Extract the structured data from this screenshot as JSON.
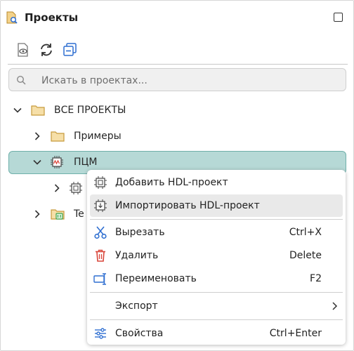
{
  "panel": {
    "title": "Проекты",
    "header_icon": "project-search-icon"
  },
  "toolbar": {
    "items": [
      {
        "icon": "eye-document-icon"
      },
      {
        "icon": "refresh-icon"
      },
      {
        "icon": "collapse-all-icon"
      }
    ]
  },
  "search": {
    "placeholder": "Искать в проектах..."
  },
  "tree": {
    "root": {
      "label": "ВСЕ ПРОЕКТЫ",
      "expanded": true,
      "icon": "folder-icon"
    },
    "examples": {
      "label": "Примеры",
      "expanded": false,
      "icon": "folder-icon"
    },
    "pcm": {
      "label": "ПЦМ",
      "expanded": true,
      "selected": true,
      "icon": "chip-signal-icon"
    },
    "pcm_child": {
      "label": "",
      "icon": "chip-icon"
    },
    "test": {
      "label": "Te",
      "icon": "folder-badge-icon"
    }
  },
  "context_menu": {
    "items": [
      {
        "label": "Добавить HDL-проект",
        "shortcut": "",
        "icon": "chip-add-icon"
      },
      {
        "label": "Импортировать HDL-проект",
        "shortcut": "",
        "icon": "chip-import-icon"
      },
      {
        "label": "Вырезать",
        "shortcut": "Ctrl+X",
        "icon": "scissors-icon"
      },
      {
        "label": "Удалить",
        "shortcut": "Delete",
        "icon": "trash-icon"
      },
      {
        "label": "Переименовать",
        "shortcut": "F2",
        "icon": "rename-icon"
      },
      {
        "label": "Экспорт",
        "shortcut": "",
        "icon": "chevron-right-icon"
      },
      {
        "label": "Свойства",
        "shortcut": "Ctrl+Enter",
        "icon": "settings-sliders-icon"
      }
    ],
    "hovered_index": 1
  },
  "colors": {
    "selected_bg": "#b6d9d6",
    "selected_border": "#6fb0aa",
    "folder": "#e9c47a",
    "accent_blue": "#2f6fd1",
    "accent_red": "#d9463b",
    "accent_green": "#3aa34a"
  }
}
